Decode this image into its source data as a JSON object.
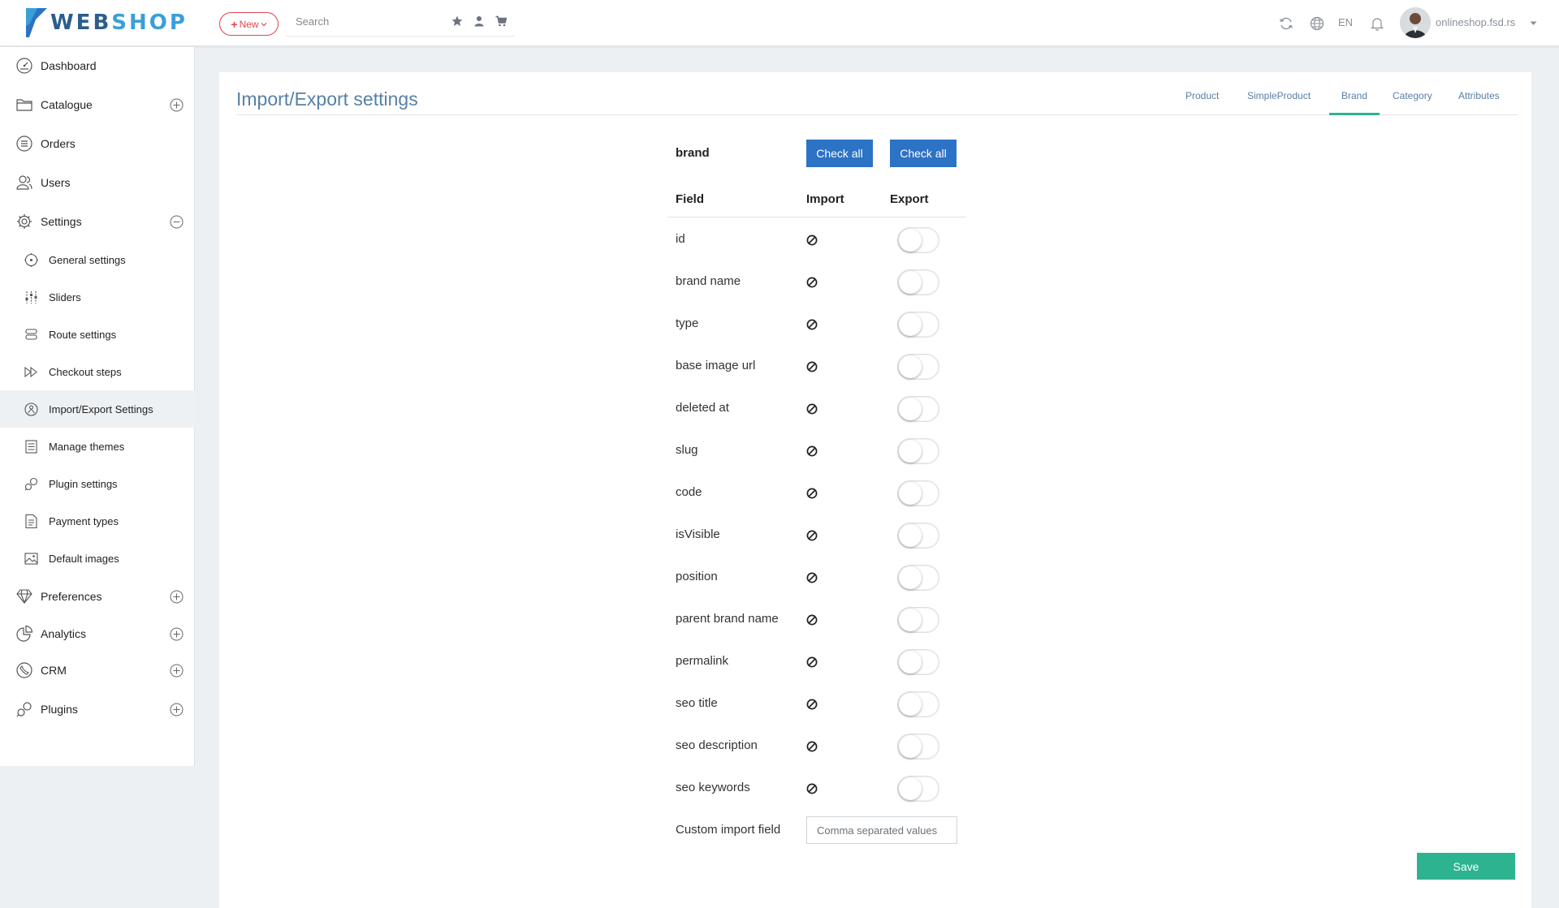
{
  "brand": {
    "web": "WEB",
    "shop": "SHOP"
  },
  "topbar": {
    "new_label": "New",
    "search_placeholder": "Search",
    "language": "EN",
    "username": "onlineshop.fsd.rs"
  },
  "sidebar": {
    "items": [
      {
        "label": "Dashboard",
        "icon": "dashboard-icon"
      },
      {
        "label": "Catalogue",
        "icon": "folder-icon",
        "toggle": "plus"
      },
      {
        "label": "Orders",
        "icon": "list-icon"
      },
      {
        "label": "Users",
        "icon": "users-icon"
      },
      {
        "label": "Settings",
        "icon": "gear-icon",
        "toggle": "minus"
      }
    ],
    "sub_items": [
      {
        "label": "General settings",
        "icon": "general-settings-icon"
      },
      {
        "label": "Sliders",
        "icon": "sliders-icon"
      },
      {
        "label": "Route settings",
        "icon": "route-icon"
      },
      {
        "label": "Checkout steps",
        "icon": "forward-icon"
      },
      {
        "label": "Import/Export Settings",
        "icon": "import-export-icon",
        "active": true
      },
      {
        "label": "Manage themes",
        "icon": "themes-icon"
      },
      {
        "label": "Plugin settings",
        "icon": "plugin-icon"
      },
      {
        "label": "Payment types",
        "icon": "payment-icon"
      },
      {
        "label": "Default images",
        "icon": "image-icon"
      }
    ],
    "bottom_items": [
      {
        "label": "Preferences",
        "icon": "diamond-icon",
        "toggle": "plus"
      },
      {
        "label": "Analytics",
        "icon": "pie-chart-icon",
        "toggle": "plus"
      },
      {
        "label": "CRM",
        "icon": "crm-icon",
        "toggle": "plus"
      },
      {
        "label": "Plugins",
        "icon": "plugin-icon",
        "toggle": "plus"
      }
    ]
  },
  "main": {
    "title": "Import/Export settings",
    "tabs": [
      "Product",
      "SimpleProduct",
      "Brand",
      "Category",
      "Attributes"
    ],
    "active_tab": "Brand",
    "section_name": "brand",
    "check_all_import": "Check all",
    "check_all_export": "Check all",
    "columns": {
      "field": "Field",
      "import": "Import",
      "export": "Export"
    },
    "rows": [
      {
        "field": "id",
        "import": "disabled",
        "export": false
      },
      {
        "field": "brand name",
        "import": "disabled",
        "export": false
      },
      {
        "field": "type",
        "import": "disabled",
        "export": false
      },
      {
        "field": "base image url",
        "import": "disabled",
        "export": false
      },
      {
        "field": "deleted at",
        "import": "disabled",
        "export": false
      },
      {
        "field": "slug",
        "import": "disabled",
        "export": false
      },
      {
        "field": "code",
        "import": "disabled",
        "export": false
      },
      {
        "field": "isVisible",
        "import": "disabled",
        "export": false
      },
      {
        "field": "position",
        "import": "disabled",
        "export": false
      },
      {
        "field": "parent brand name",
        "import": "disabled",
        "export": false
      },
      {
        "field": "permalink",
        "import": "disabled",
        "export": false
      },
      {
        "field": "seo title",
        "import": "disabled",
        "export": false
      },
      {
        "field": "seo description",
        "import": "disabled",
        "export": false
      },
      {
        "field": "seo keywords",
        "import": "disabled",
        "export": false
      }
    ],
    "custom_field_label": "Custom import field",
    "custom_field_placeholder": "Comma separated values",
    "save_label": "Save"
  },
  "colors": {
    "accent_green": "#2db38f",
    "button_blue": "#2c72c5",
    "title_blue": "#587fa6",
    "new_red": "#e0474c"
  }
}
